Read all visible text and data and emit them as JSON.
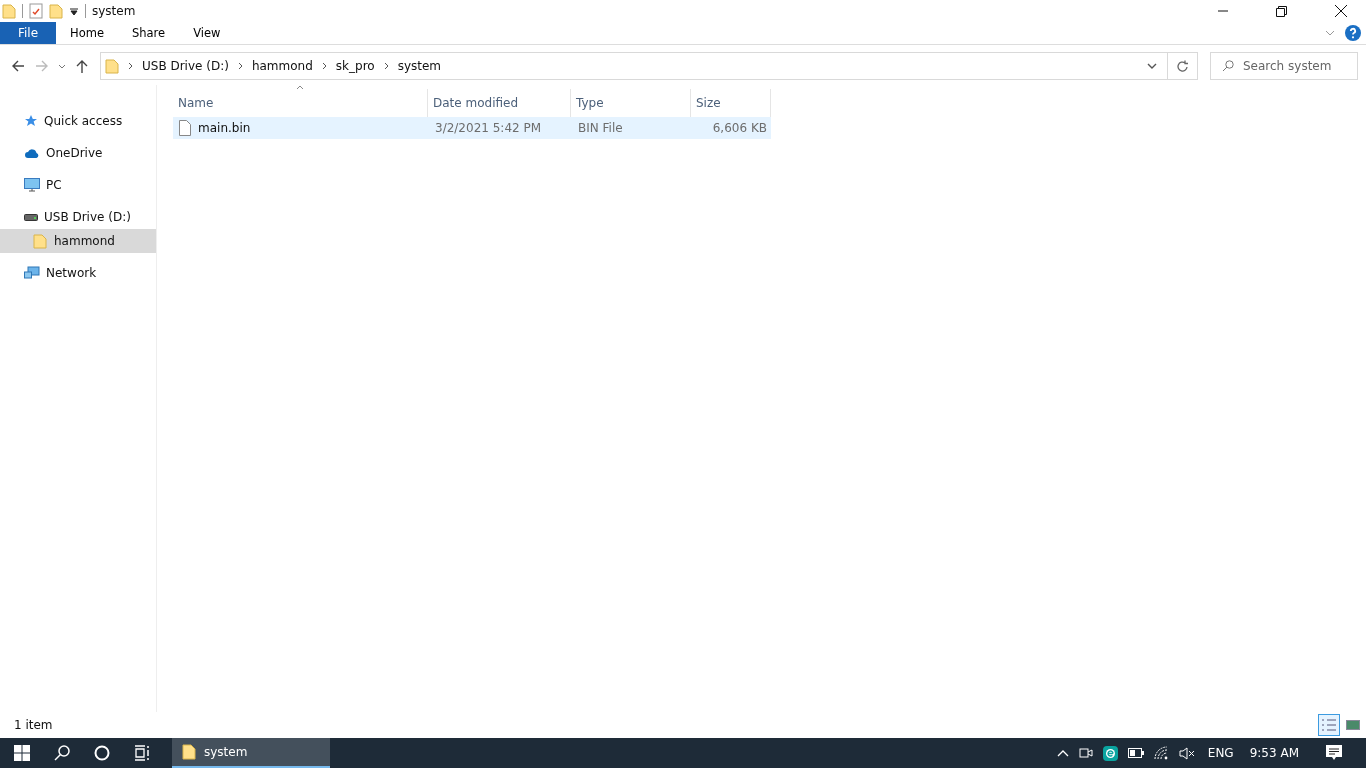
{
  "window": {
    "title": "system"
  },
  "ribbon_tabs": [
    {
      "label": "File",
      "kind": "file",
      "selected": false
    },
    {
      "label": "Home",
      "kind": "tab",
      "selected": false
    },
    {
      "label": "Share",
      "kind": "tab",
      "selected": false
    },
    {
      "label": "View",
      "kind": "tab",
      "selected": false
    }
  ],
  "address": {
    "path": [
      "USB Drive (D:)",
      "hammond",
      "sk_pro",
      "system"
    ]
  },
  "search": {
    "placeholder": "Search system"
  },
  "sidebar": {
    "items": [
      {
        "label": "Quick access",
        "kind": "star",
        "selected": false
      },
      {
        "label": "OneDrive",
        "kind": "cloud",
        "selected": false
      },
      {
        "label": "PC",
        "kind": "pc",
        "selected": false
      },
      {
        "label": "USB Drive (D:)",
        "kind": "drive",
        "selected": false,
        "children": [
          {
            "label": "hammond",
            "kind": "folder",
            "selected": true
          }
        ]
      },
      {
        "label": "Network",
        "kind": "network",
        "selected": false
      }
    ]
  },
  "table": {
    "columns": [
      "Name",
      "Date modified",
      "Type",
      "Size"
    ],
    "rows": [
      {
        "name": "main.bin",
        "date": "3/2/2021 5:42 PM",
        "type": "BIN File",
        "size": "6,606 KB",
        "selected": true
      }
    ]
  },
  "status_bar": {
    "text": "1 item",
    "views": [
      {
        "kind": "details",
        "selected": true
      },
      {
        "kind": "thumbnails",
        "selected": false
      }
    ]
  },
  "taskbar": {
    "apps": [
      {
        "label": "system",
        "selected": true
      }
    ],
    "language": "ENG",
    "time": "9:53 AM"
  }
}
